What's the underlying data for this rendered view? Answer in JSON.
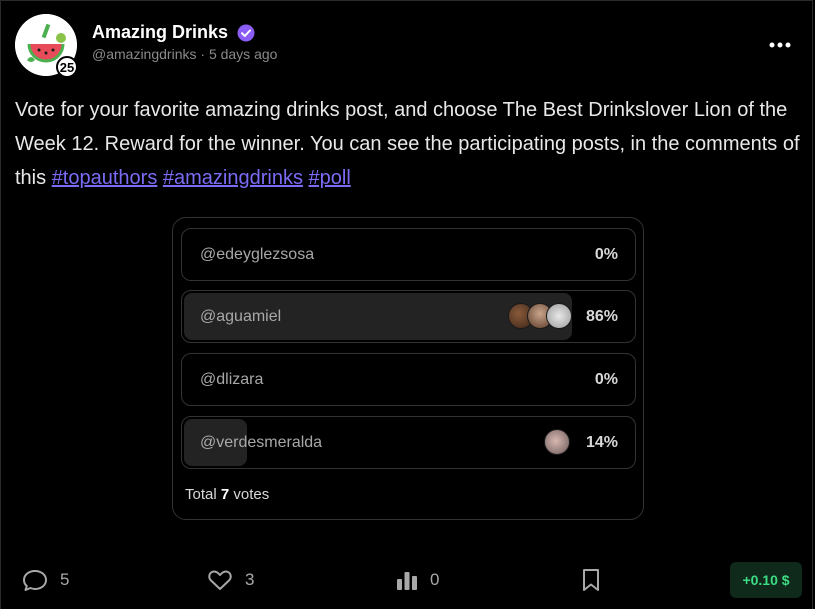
{
  "author": {
    "name": "Amazing Drinks",
    "handle": "@amazingdrinks",
    "separator": "·",
    "time": "5 days ago",
    "level": "25",
    "verified": true,
    "avatar_text": "Amazing Drinks"
  },
  "post": {
    "text": "Vote for your favorite amazing drinks post, and choose The Best Drinkslover Lion of the Week 12. Reward for the winner. You can see the participating posts, in the comments of this ",
    "hashtags": [
      "#topauthors",
      "#amazingdrinks",
      "#poll"
    ]
  },
  "poll": {
    "options": [
      {
        "label": "@edeyglezsosa",
        "percent_text": "0%",
        "percent": 0,
        "voters": 0
      },
      {
        "label": "@aguamiel",
        "percent_text": "86%",
        "percent": 86,
        "voters": 3
      },
      {
        "label": "@dlizara",
        "percent_text": "0%",
        "percent": 0,
        "voters": 0
      },
      {
        "label": "@verdesmeralda",
        "percent_text": "14%",
        "percent": 14,
        "voters": 1
      }
    ],
    "total_prefix": "Total",
    "total_votes": "7",
    "total_suffix": "votes"
  },
  "actions": {
    "comments": "5",
    "likes": "3",
    "views": "0",
    "reward": "+0.10 $"
  },
  "colors": {
    "background": "#000000",
    "accent": "#7b6cf6",
    "verified": "#8b5cf6",
    "reward_text": "#3ddc84",
    "reward_bg": "#0f2a1a"
  },
  "icons": [
    "more-icon",
    "verified-icon",
    "comment-icon",
    "heart-icon",
    "stats-icon",
    "bookmark-icon"
  ]
}
